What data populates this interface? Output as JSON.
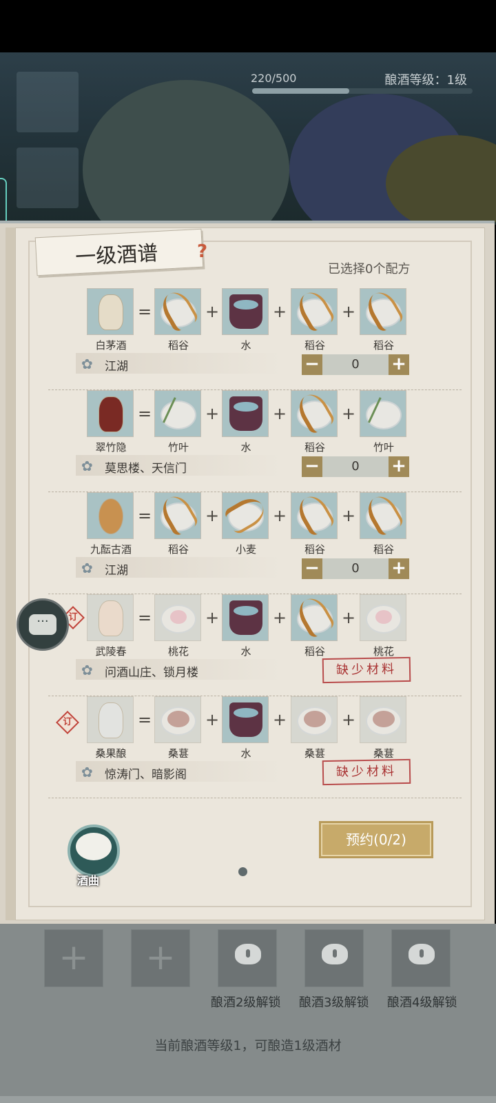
{
  "status": {
    "xp": "220/500",
    "xp_ratio": 0.44,
    "brew_level": "酿酒等级：1级"
  },
  "book": {
    "title": "一级酒谱",
    "selected_count": "已选择0个配方",
    "recipes": [
      {
        "name": "白茅酒",
        "ingredients": [
          "稻谷",
          "水",
          "稻谷",
          "稻谷"
        ],
        "origin": "江湖",
        "count": "0"
      },
      {
        "name": "翠竹隐",
        "ingredients": [
          "竹叶",
          "水",
          "稻谷",
          "竹叶"
        ],
        "origin": "莫思楼、天信门",
        "count": "0"
      },
      {
        "name": "九酝古酒",
        "ingredients": [
          "稻谷",
          "小麦",
          "稻谷",
          "稻谷"
        ],
        "origin": "江湖",
        "count": "0"
      },
      {
        "name": "武陵春",
        "ingredients": [
          "桃花",
          "水",
          "稻谷",
          "桃花"
        ],
        "origin": "问酒山庄、锁月楼",
        "status": "缺少材料"
      },
      {
        "name": "桑果酿",
        "ingredients": [
          "桑葚",
          "水",
          "桑葚",
          "桑葚"
        ],
        "origin": "惊涛门、暗影阁",
        "status": "缺少材料"
      }
    ],
    "lock_badge": "订",
    "reserve_label": "预约(0/2)",
    "koji_label": "酒曲"
  },
  "slots": {
    "unlock_labels": [
      "酿酒2级解锁",
      "酿酒3级解锁",
      "酿酒4级解锁"
    ]
  },
  "footer": "当前酿酒等级1，可酿造1级酒材",
  "icons": {
    "minus": "−",
    "plus": "+",
    "equals": "=",
    "chat": "chat-icon",
    "flower": "flower-icon"
  }
}
